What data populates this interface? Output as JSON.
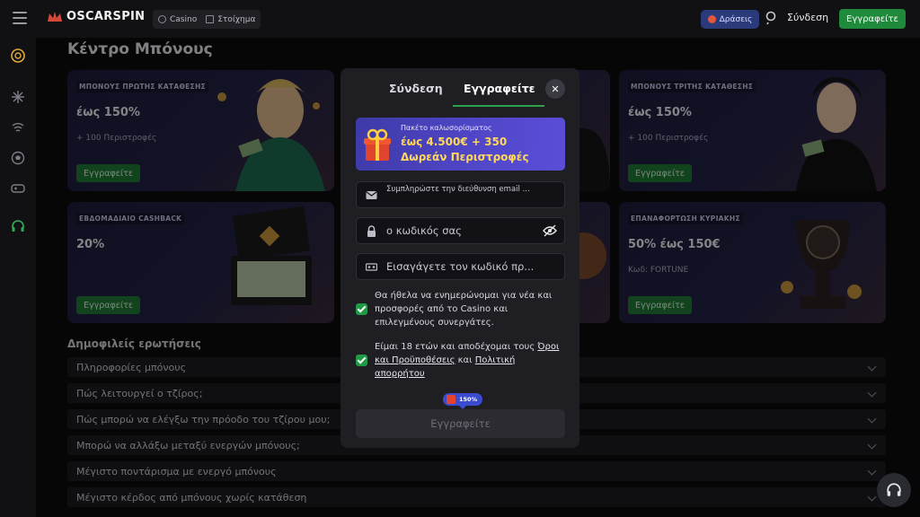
{
  "header": {
    "logo_text": "OSCARSPIN",
    "tabs": [
      {
        "label": "Casino"
      },
      {
        "label": "Στοίχημα"
      }
    ],
    "promo_label": "Δράσεις",
    "login_label": "Σύνδεση",
    "register_label": "Εγγραφείτε"
  },
  "page": {
    "title": "Κέντρο Μπόνους"
  },
  "bonus_cards": [
    {
      "tag": "ΜΠΟΝΟΥΣ ΠΡΩΤΗΣ ΚΑΤΑΘΕΣΗΣ",
      "amount": "έως 150%",
      "extra": "+ 100 Περιστροφές",
      "button": "Εγγραφείτε"
    },
    {
      "tag": "",
      "amount": "",
      "extra": "",
      "button": ""
    },
    {
      "tag": "ΜΠΟΝΟΥΣ ΤΡΙΤΗΣ ΚΑΤΑΘΕΣΗΣ",
      "amount": "έως 150%",
      "extra": "+ 100 Περιστροφές",
      "button": "Εγγραφείτε"
    },
    {
      "tag": "ΕΒΔΟΜΑΔΙΑΙΟ CASHBACK",
      "amount": "20%",
      "extra": "",
      "button": "Εγγραφείτε"
    },
    {
      "tag": "",
      "amount": "",
      "extra": "",
      "button": ""
    },
    {
      "tag": "ΕΠΑΝΑΦΟΡΤΩΣΗ ΚΥΡΙΑΚΗΣ",
      "amount": "50% έως 150€",
      "extra": "Κωδ: FORTUNE",
      "button": "Εγγραφείτε"
    }
  ],
  "faq": {
    "title": "Δημοφιλείς ερωτήσεις",
    "items": [
      "Πληροφορίες μπόνους",
      "Πώς λειτουργεί ο τζίρος;",
      "Πώς μπορώ να ελέγξω την πρόοδο του τζίρου μου;",
      "Μπορώ να αλλάξω μεταξύ ενεργών μπόνους;",
      "Μέγιστο ποντάρισμα με ενεργό μπόνους",
      "Μέγιστο κέρδος από μπόνους χωρίς κατάθεση"
    ]
  },
  "modal": {
    "tab_login": "Σύνδεση",
    "tab_register": "Εγγραφείτε",
    "close_symbol": "✕",
    "banner": {
      "line1": "Πακέτο καλωσορίσματος",
      "line2": "έως 4.500€ + 350",
      "line3": "Δωρεάν Περιστροφές"
    },
    "email_placeholder": "Συμπληρώστε την διεύθυνση email ...",
    "password_placeholder": "ο κωδικός σας",
    "promo_placeholder": "Εισαγάγετε τον κωδικό πρ...",
    "newsletter_text": "Θα ήθελα να ενημερώνομαι για νέα και προσφορές από το Casino και επιλεγμένους συνεργάτες.",
    "terms_prefix": "Είμαι 18 ετών και αποδέχομαι τους ",
    "terms_link": "Όροι και Προϋποθέσεις",
    "terms_middle": " και ",
    "privacy_link": "Πολιτική απορρήτου",
    "pill_label": "150%",
    "submit_label": "Εγγραφείτε"
  },
  "colors": {
    "accent_green": "#1f8a3c",
    "banner_purple": "#5147c9",
    "banner_yellow": "#ffd85a"
  }
}
